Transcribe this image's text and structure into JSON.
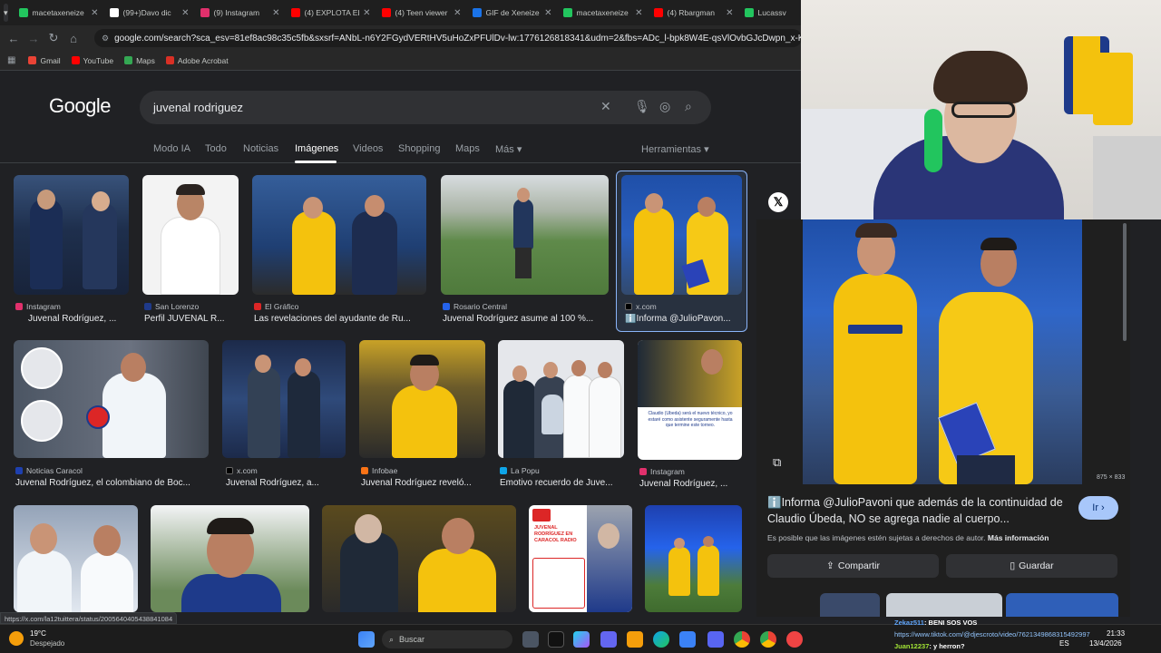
{
  "browser": {
    "tabs": [
      {
        "label": "macetaxeneize",
        "icon_color": "#22c55e"
      },
      {
        "label": "(99+)Davo dic",
        "icon_color": "#ffffff"
      },
      {
        "label": "(9) Instagram",
        "icon_color": "#e1306c"
      },
      {
        "label": "(4) EXPLOTA EL",
        "icon_color": "#ff0000"
      },
      {
        "label": "(4) Teen viewer",
        "icon_color": "#ff0000"
      },
      {
        "label": "GIF de Xeneize",
        "icon_color": "#1a73e8"
      },
      {
        "label": "macetaxeneize",
        "icon_color": "#22c55e"
      },
      {
        "label": "(4) Rbargman",
        "icon_color": "#ff0000"
      },
      {
        "label": "Lucassv",
        "icon_color": "#22c55e"
      }
    ],
    "url": "google.com/search?sca_esv=81ef8ac98c35c5fb&sxsrf=ANbL-n6Y2FGydVERtHV5uHoZxPFUlDv-lw:1776126818341&udm=2&fbs=ADc_l-bpk8W4E-qsVlOvbGJcDwpn_x-KoZgS_dlzvUJcC",
    "bookmarks": [
      {
        "label": "Gmail",
        "icon_color": "#ea4335"
      },
      {
        "label": "YouTube",
        "icon_color": "#ff0000"
      },
      {
        "label": "Maps",
        "icon_color": "#34a853"
      },
      {
        "label": "Adobe Acrobat",
        "icon_color": "#d93025"
      }
    ]
  },
  "google": {
    "logo": "Google",
    "query": "juvenal rodriguez",
    "nav": [
      "Modo IA",
      "Todo",
      "Noticias",
      "Imágenes",
      "Videos",
      "Shopping",
      "Maps",
      "Más ▾",
      "Herramientas ▾"
    ],
    "active_nav": "Imágenes"
  },
  "results": [
    {
      "source": "Instagram",
      "title": "Juvenal Rodríguez, ...",
      "fav": "#e1306c"
    },
    {
      "source": "San Lorenzo",
      "title": "Perfil JUVENAL R...",
      "fav": "#1f3a8a"
    },
    {
      "source": "El Gráfico",
      "title": "Las revelaciones del ayudante de Ru...",
      "fav": "#dc2626"
    },
    {
      "source": "Rosario Central",
      "title": "Juvenal Rodríguez asume al 100 %...",
      "fav": "#2563eb"
    },
    {
      "source": "x.com",
      "title": "ℹ️Informa @JulioPavon...",
      "fav": "#000000"
    },
    {
      "source": "Noticias Caracol",
      "title": "Juvenal Rodríguez, el colombiano de Boc...",
      "fav": "#1e40af"
    },
    {
      "source": "x.com",
      "title": "Juvenal Rodríguez, a...",
      "fav": "#000000"
    },
    {
      "source": "Infobae",
      "title": "Juvenal Rodríguez reveló...",
      "fav": "#f97316"
    },
    {
      "source": "La Popu",
      "title": "Emotivo recuerdo de Juve...",
      "fav": "#0ea5e9"
    },
    {
      "source": "Instagram",
      "title": "Juvenal Rodríguez, ...",
      "fav": "#e1306c"
    }
  ],
  "thumb_text": {
    "claudio": "Claudio (Úbeda) será el nuevo técnico, yo estaré como asistente seguramente hasta que termine este torneo.",
    "dep_header": "JUVENAL RODRÍGUEZ EN CARACOL RADIO"
  },
  "panel": {
    "image_size": "875 × 833",
    "title": "ℹ️Informa @JulioPavoni que además de la continuidad de Claudio Úbeda, NO se agrega nadie al cuerpo...",
    "go_label": "Ir ›",
    "copyright": "Es posible que las imágenes estén sujetas a derechos de autor.",
    "more_info": "Más información",
    "share_label": "Compartir",
    "save_label": "Guardar"
  },
  "status_url": "https://x.com/la12tuittera/status/2005640405438841084",
  "taskbar": {
    "weather_temp": "19°C",
    "weather_desc": "Despejado",
    "search_label": "Buscar",
    "lang": "ES",
    "time": "21:33",
    "date": "13/4/2026"
  },
  "chat": [
    {
      "user": "Zekaz511",
      "text": ": BENI SOS VOS"
    },
    {
      "user": "",
      "text": "https://www.tiktok.com/@djescroto/video/7621349868315492997"
    },
    {
      "user": "Juan12237",
      "text": ": y herron?"
    }
  ]
}
